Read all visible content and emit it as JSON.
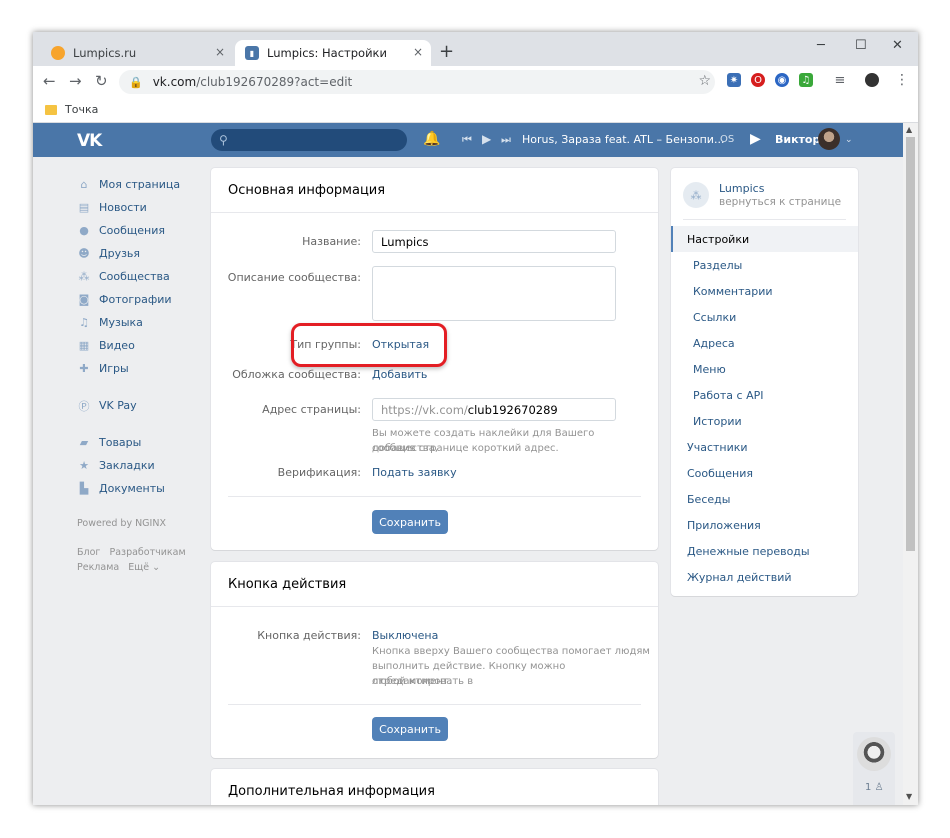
{
  "browser": {
    "tabs": [
      {
        "title": "Lumpics.ru"
      },
      {
        "title": "Lumpics: Настройки"
      }
    ],
    "url_host": "vk.com",
    "url_path": "/club192670289?act=edit",
    "bookmark": "Точка",
    "tab_close": "×",
    "new_tab": "+"
  },
  "vk": {
    "logo": "VK",
    "track": "Horus, Зараза feat. ATL – Бензопи...",
    "user_name": "Виктор",
    "os_label": "OS"
  },
  "leftnav": {
    "items": [
      {
        "label": "Моя страница",
        "icon": "home-icon"
      },
      {
        "label": "Новости",
        "icon": "news-icon"
      },
      {
        "label": "Сообщения",
        "icon": "messages-icon"
      },
      {
        "label": "Друзья",
        "icon": "friends-icon"
      },
      {
        "label": "Сообщества",
        "icon": "communities-icon"
      },
      {
        "label": "Фотографии",
        "icon": "camera-icon"
      },
      {
        "label": "Музыка",
        "icon": "music-icon"
      },
      {
        "label": "Видео",
        "icon": "video-icon"
      },
      {
        "label": "Игры",
        "icon": "gamepad-icon"
      }
    ],
    "vkpay": "VK Pay",
    "items2": [
      {
        "label": "Товары",
        "icon": "bag-icon"
      },
      {
        "label": "Закладки",
        "icon": "star-icon"
      },
      {
        "label": "Документы",
        "icon": "document-icon"
      }
    ],
    "powered": "Powered by NGINX",
    "footer1a": "Блог",
    "footer1b": "Разработчикам",
    "footer2a": "Реклама",
    "footer2b": "Ещё"
  },
  "main": {
    "info_title": "Основная информация",
    "name_label": "Название:",
    "name_value": "Lumpics",
    "desc_label": "Описание сообщества:",
    "type_label": "Тип группы:",
    "type_value": "Открытая",
    "cover_label": "Обложка сообщества:",
    "cover_value": "Добавить",
    "address_label": "Адрес страницы:",
    "address_prefix": "https://vk.com/",
    "address_value": "club192670289",
    "address_hint1": "Вы можете создать наклейки для Вашего сообщества,",
    "address_hint2": "добавив странице короткий адрес.",
    "verify_label": "Верификация:",
    "verify_value": "Подать заявку",
    "save": "Сохранить",
    "action_title": "Кнопка действия",
    "action_label": "Кнопка действия:",
    "action_value": "Выключена",
    "action_hint1": "Кнопка вверху Вашего сообщества помогает людям",
    "action_hint2": "выполнить действие. Кнопку можно отредактировать в",
    "action_hint3": "любой момент.",
    "extra_title": "Дополнительная информация"
  },
  "rightmenu": {
    "group_name": "Lumpics",
    "back": "вернуться к странице",
    "items": [
      {
        "label": "Настройки",
        "kind": "active"
      },
      {
        "label": "Разделы",
        "kind": "sub"
      },
      {
        "label": "Комментарии",
        "kind": "sub"
      },
      {
        "label": "Ссылки",
        "kind": "sub"
      },
      {
        "label": "Адреса",
        "kind": "sub"
      },
      {
        "label": "Меню",
        "kind": "sub"
      },
      {
        "label": "Работа с API",
        "kind": "sub"
      },
      {
        "label": "Истории",
        "kind": "sub"
      },
      {
        "label": "Участники",
        "kind": "top"
      },
      {
        "label": "Сообщения",
        "kind": "top"
      },
      {
        "label": "Беседы",
        "kind": "top"
      },
      {
        "label": "Приложения",
        "kind": "top"
      },
      {
        "label": "Денежные переводы",
        "kind": "top"
      },
      {
        "label": "Журнал действий",
        "kind": "top"
      }
    ]
  },
  "chat": {
    "count": "1"
  },
  "colors": {
    "vk_blue": "#4a76a8",
    "link": "#2a5885",
    "button": "#5181b8",
    "highlight": "#e31e24"
  }
}
